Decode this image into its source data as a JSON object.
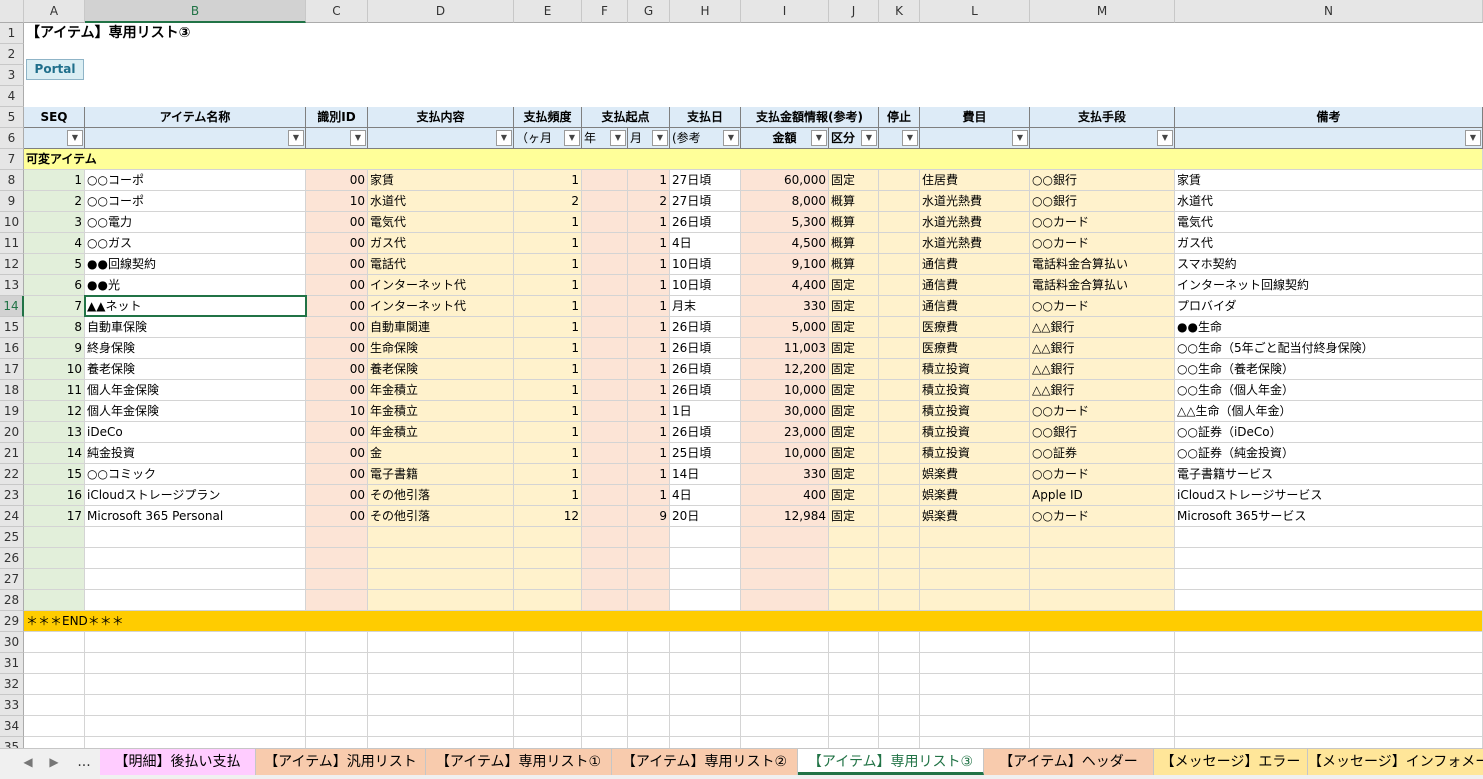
{
  "columns": [
    "A",
    "B",
    "C",
    "D",
    "E",
    "F",
    "G",
    "H",
    "I",
    "J",
    "K",
    "L",
    "M",
    "N"
  ],
  "title": "【アイテム】専用リスト③",
  "portal_label": "Portal",
  "headers": {
    "seq": "SEQ",
    "item_name": "アイテム名称",
    "id": "識別ID",
    "content": "支払内容",
    "freq": "支払頻度",
    "freq_sub": "（ヶ月",
    "start": "支払起点",
    "start_year": "年",
    "start_month": "月",
    "payday": "支払日",
    "payday_sub": "(参考",
    "amount_info": "支払金額情報(参考)",
    "amount": "金額",
    "kind": "区分",
    "stop": "停止",
    "expense": "費目",
    "method": "支払手段",
    "note": "備考"
  },
  "section_label": "可変アイテム",
  "end_label": "＊＊＊END＊＊＊",
  "rows": [
    {
      "seq": "1",
      "name": "○○コーポ",
      "id": "00",
      "content": "家賃",
      "freq": "1",
      "month": "1",
      "day": "27日頃",
      "amount": "60,000",
      "kind": "固定",
      "expense": "住居費",
      "method": "○○銀行",
      "note": "家賃"
    },
    {
      "seq": "2",
      "name": "○○コーポ",
      "id": "10",
      "content": "水道代",
      "freq": "2",
      "month": "2",
      "day": "27日頃",
      "amount": "8,000",
      "kind": "概算",
      "expense": "水道光熱費",
      "method": "○○銀行",
      "note": "水道代"
    },
    {
      "seq": "3",
      "name": "○○電力",
      "id": "00",
      "content": "電気代",
      "freq": "1",
      "month": "1",
      "day": "26日頃",
      "amount": "5,300",
      "kind": "概算",
      "expense": "水道光熱費",
      "method": "○○カード",
      "note": "電気代"
    },
    {
      "seq": "4",
      "name": "○○ガス",
      "id": "00",
      "content": "ガス代",
      "freq": "1",
      "month": "1",
      "day": "4日",
      "amount": "4,500",
      "kind": "概算",
      "expense": "水道光熱費",
      "method": "○○カード",
      "note": "ガス代"
    },
    {
      "seq": "5",
      "name": "●●回線契約",
      "id": "00",
      "content": "電話代",
      "freq": "1",
      "month": "1",
      "day": "10日頃",
      "amount": "9,100",
      "kind": "概算",
      "expense": "通信費",
      "method": "電話料金合算払い",
      "note": "スマホ契約"
    },
    {
      "seq": "6",
      "name": "●●光",
      "id": "00",
      "content": "インターネット代",
      "freq": "1",
      "month": "1",
      "day": "10日頃",
      "amount": "4,400",
      "kind": "固定",
      "expense": "通信費",
      "method": "電話料金合算払い",
      "note": "インターネット回線契約"
    },
    {
      "seq": "7",
      "name": "▲▲ネット",
      "id": "00",
      "content": "インターネット代",
      "freq": "1",
      "month": "1",
      "day": "月末",
      "amount": "330",
      "kind": "固定",
      "expense": "通信費",
      "method": "○○カード",
      "note": "プロバイダ"
    },
    {
      "seq": "8",
      "name": "自動車保険",
      "id": "00",
      "content": "自動車関連",
      "freq": "1",
      "month": "1",
      "day": "26日頃",
      "amount": "5,000",
      "kind": "固定",
      "expense": "医療費",
      "method": "△△銀行",
      "note": "●●生命"
    },
    {
      "seq": "9",
      "name": "終身保険",
      "id": "00",
      "content": "生命保険",
      "freq": "1",
      "month": "1",
      "day": "26日頃",
      "amount": "11,003",
      "kind": "固定",
      "expense": "医療費",
      "method": "△△銀行",
      "note": "○○生命（5年ごと配当付終身保険）"
    },
    {
      "seq": "10",
      "name": "養老保険",
      "id": "00",
      "content": "養老保険",
      "freq": "1",
      "month": "1",
      "day": "26日頃",
      "amount": "12,200",
      "kind": "固定",
      "expense": "積立投資",
      "method": "△△銀行",
      "note": "○○生命（養老保険）"
    },
    {
      "seq": "11",
      "name": "個人年金保険",
      "id": "00",
      "content": "年金積立",
      "freq": "1",
      "month": "1",
      "day": "26日頃",
      "amount": "10,000",
      "kind": "固定",
      "expense": "積立投資",
      "method": "△△銀行",
      "note": "○○生命（個人年金）"
    },
    {
      "seq": "12",
      "name": "個人年金保険",
      "id": "10",
      "content": "年金積立",
      "freq": "1",
      "month": "1",
      "day": "1日",
      "amount": "30,000",
      "kind": "固定",
      "expense": "積立投資",
      "method": "○○カード",
      "note": "△△生命（個人年金）"
    },
    {
      "seq": "13",
      "name": "iDeCo",
      "id": "00",
      "content": "年金積立",
      "freq": "1",
      "month": "1",
      "day": "26日頃",
      "amount": "23,000",
      "kind": "固定",
      "expense": "積立投資",
      "method": "○○銀行",
      "note": "○○証券（iDeCo）"
    },
    {
      "seq": "14",
      "name": "純金投資",
      "id": "00",
      "content": "金",
      "freq": "1",
      "month": "1",
      "day": "25日頃",
      "amount": "10,000",
      "kind": "固定",
      "expense": "積立投資",
      "method": "○○証券",
      "note": "○○証券（純金投資）"
    },
    {
      "seq": "15",
      "name": "○○コミック",
      "id": "00",
      "content": "電子書籍",
      "freq": "1",
      "month": "1",
      "day": "14日",
      "amount": "330",
      "kind": "固定",
      "expense": "娯楽費",
      "method": "○○カード",
      "note": "電子書籍サービス"
    },
    {
      "seq": "16",
      "name": "iCloudストレージプラン",
      "id": "00",
      "content": "その他引落",
      "freq": "1",
      "month": "1",
      "day": "4日",
      "amount": "400",
      "kind": "固定",
      "expense": "娯楽費",
      "method": "Apple ID",
      "note": "iCloudストレージサービス"
    },
    {
      "seq": "17",
      "name": "Microsoft 365 Personal",
      "id": "00",
      "content": "その他引落",
      "freq": "12",
      "month": "9",
      "day": "20日",
      "amount": "12,984",
      "kind": "固定",
      "expense": "娯楽費",
      "method": "○○カード",
      "note": "Microsoft 365サービス"
    }
  ],
  "sheet_tabs": [
    {
      "label": "【明細】後払い支払",
      "color": "#ffccff"
    },
    {
      "label": "【アイテム】汎用リスト",
      "color": "#f8cbad"
    },
    {
      "label": "【アイテム】専用リスト①",
      "color": "#f8cbad"
    },
    {
      "label": "【アイテム】専用リスト②",
      "color": "#f8cbad"
    },
    {
      "label": "【アイテム】専用リスト③",
      "color": "#ffffff",
      "active": true
    },
    {
      "label": "【アイテム】ヘッダー",
      "color": "#f8cbad"
    },
    {
      "label": "【メッセージ】エラー",
      "color": "#ffe699"
    },
    {
      "label": "【メッセージ】インフォメーション",
      "color": "#ffe699"
    }
  ],
  "nav": {
    "prev": "◀",
    "next": "▶",
    "more": "..."
  }
}
